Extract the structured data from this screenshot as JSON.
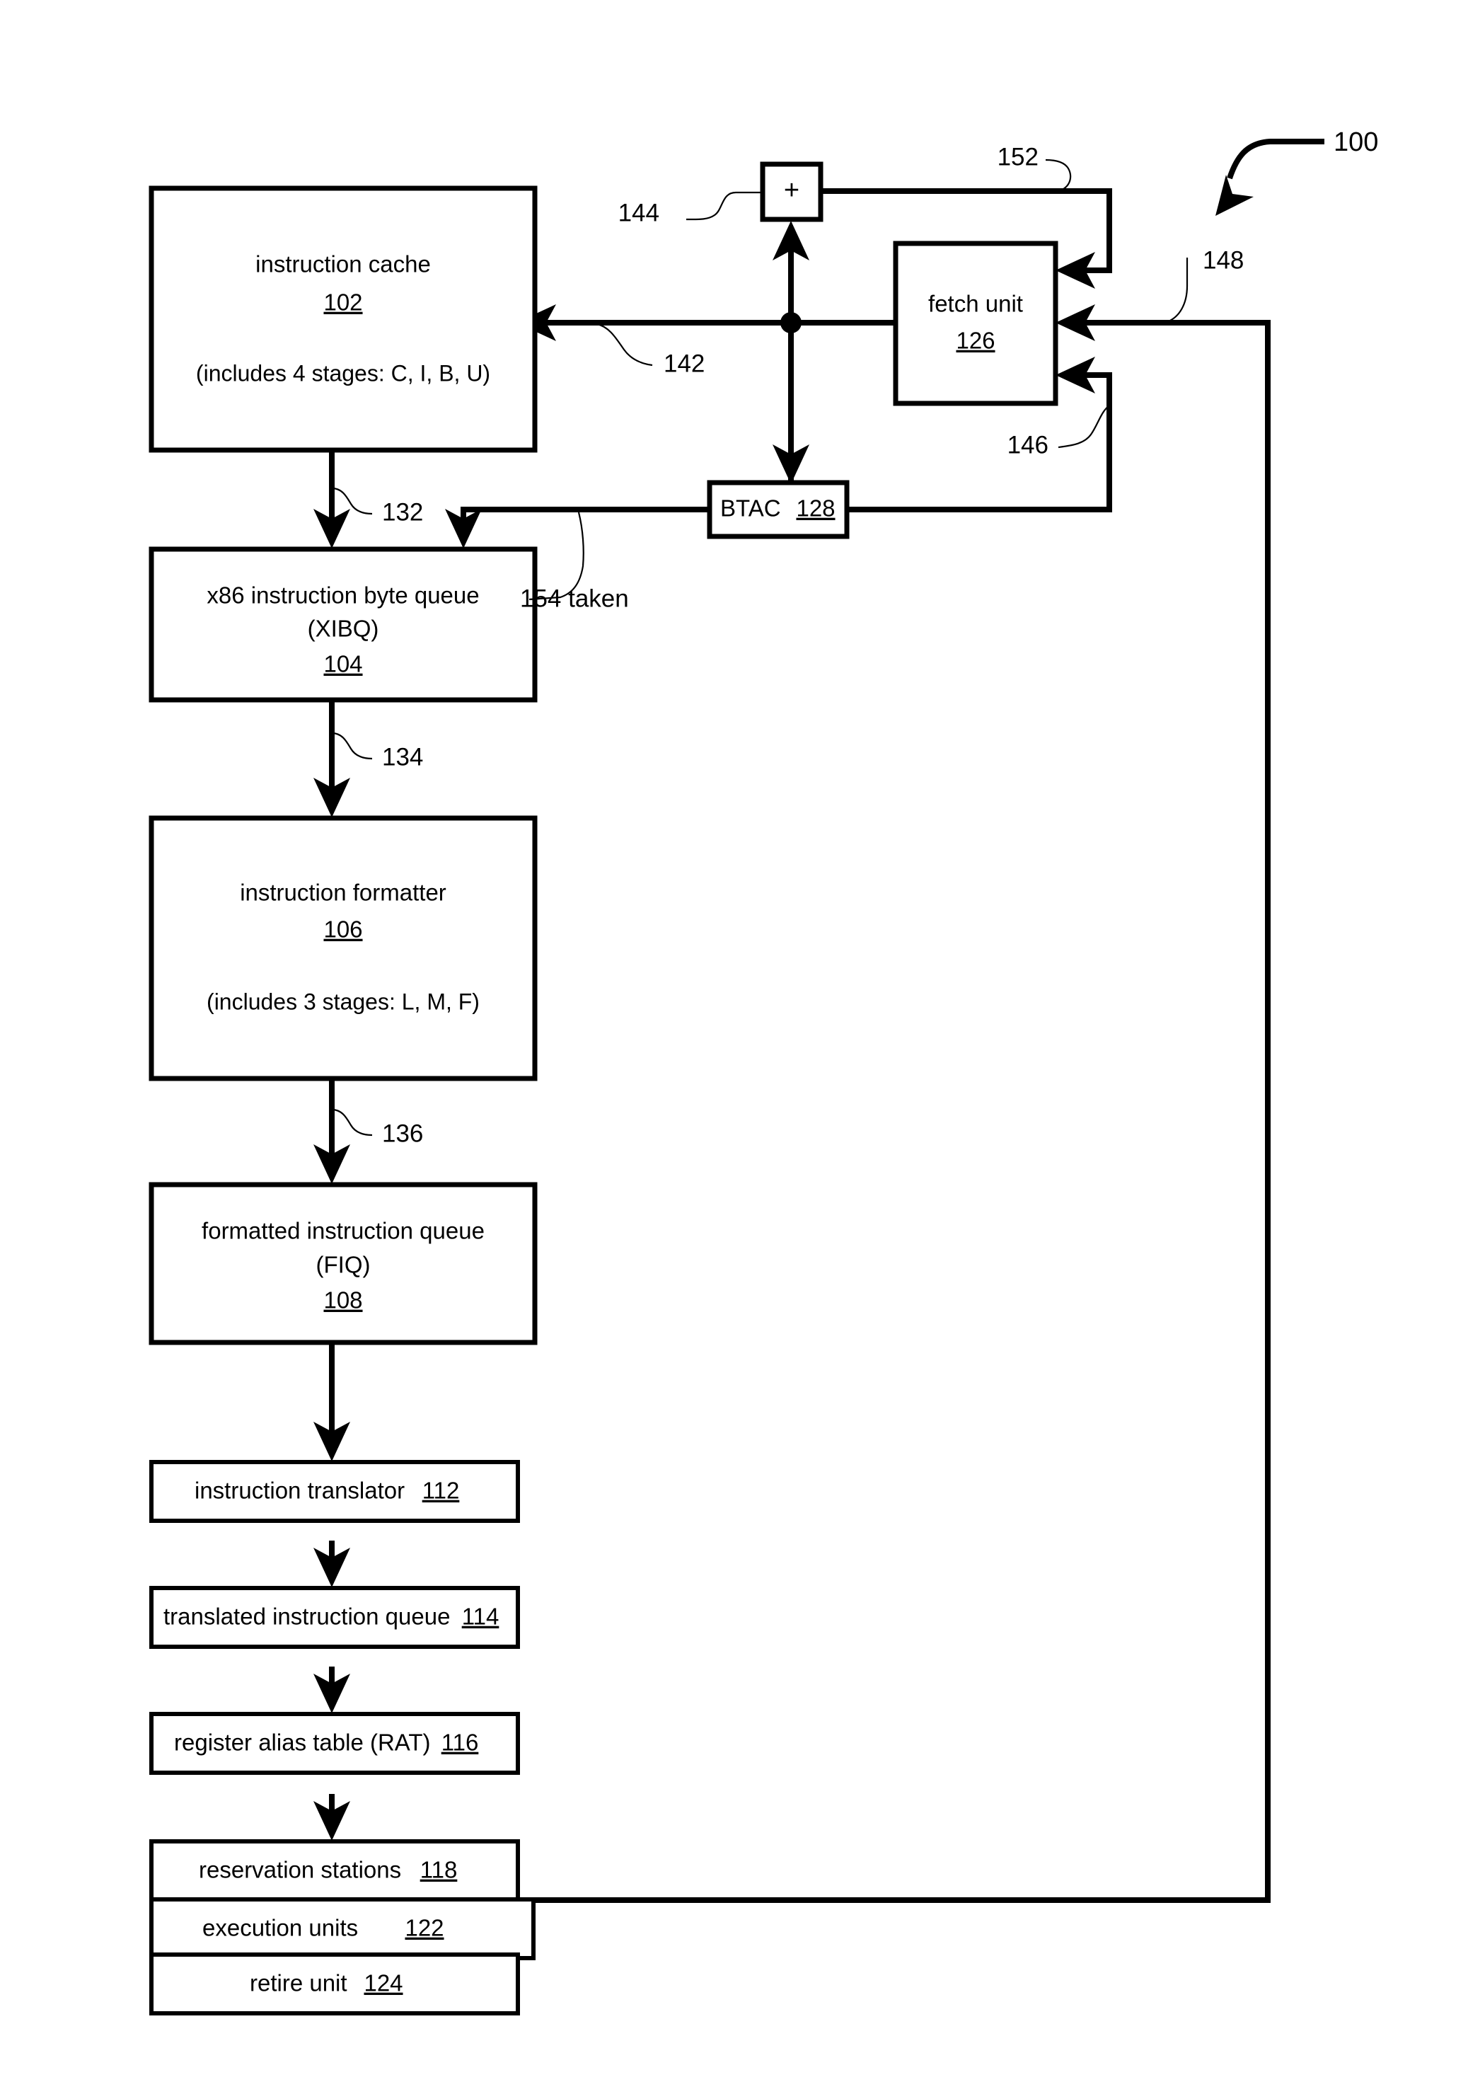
{
  "figure": {
    "figure_ref": "100",
    "title_blocks": [
      {
        "id": "instruction-cache",
        "line1": "instruction cache",
        "ref": "102",
        "line3": "(includes 4 stages: C, I, B, U)"
      },
      {
        "id": "xibq",
        "line1": "x86 instruction byte queue",
        "line2": "(XIBQ)",
        "ref": "104"
      },
      {
        "id": "instruction-formatter",
        "line1": "instruction formatter",
        "ref": "106",
        "line3": "(includes 3 stages: L, M, F)"
      },
      {
        "id": "fiq",
        "line1": "formatted instruction queue",
        "line2": "(FIQ)",
        "ref": "108"
      }
    ],
    "inline_blocks": [
      {
        "id": "instruction-translator",
        "label": "instruction translator",
        "ref": "112"
      },
      {
        "id": "translated-instruction-queue",
        "label": "translated instruction queue",
        "ref": "114"
      },
      {
        "id": "register-alias-table",
        "label": "register alias table (RAT)",
        "ref": "116"
      },
      {
        "id": "reservation-stations",
        "label": "reservation stations",
        "ref": "118"
      },
      {
        "id": "execution-units",
        "label": "execution units",
        "ref": "122"
      },
      {
        "id": "retire-unit",
        "label": "retire unit",
        "ref": "124"
      }
    ],
    "fetch_unit": {
      "label": "fetch unit",
      "ref": "126"
    },
    "btac": {
      "label": "BTAC",
      "ref": "128"
    },
    "adder": {
      "symbol": "+",
      "ref": "144"
    },
    "signal_labels": {
      "s132": "132",
      "s134": "134",
      "s136": "136",
      "s142": "142",
      "s144": "144",
      "s146": "146",
      "s148": "148",
      "s152": "152",
      "s154": "154 taken"
    },
    "colors": {
      "ink": "#000000",
      "paper": "#ffffff"
    }
  }
}
